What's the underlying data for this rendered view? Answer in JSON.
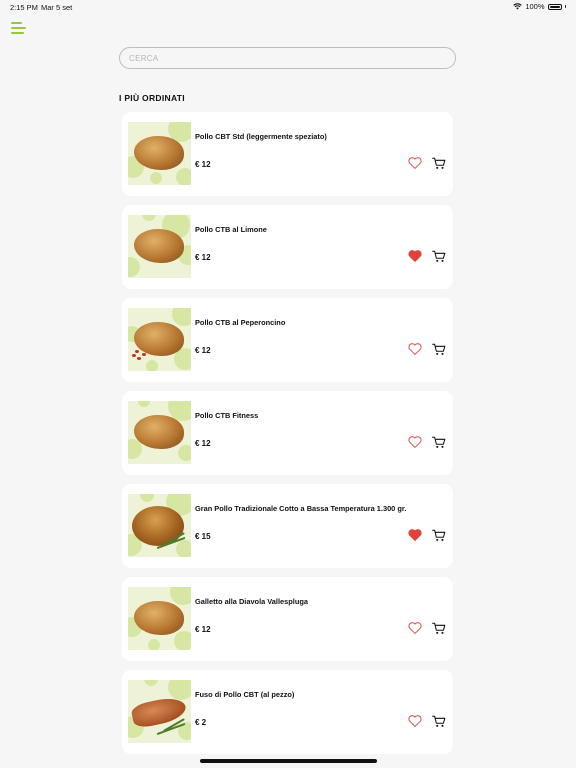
{
  "status_bar": {
    "time": "2:15 PM",
    "date": "Mar 5 set",
    "battery": "100%"
  },
  "search": {
    "placeholder": "CERCA"
  },
  "section_title": "I PIÙ ORDINATI",
  "colors": {
    "accent": "#9bc53d",
    "favorite_active": "#e0433a",
    "favorite_inactive": "#d9534f"
  },
  "products": [
    {
      "name": "Pollo CBT Std  (leggermente speziato)",
      "price": "€ 12",
      "favorite": false
    },
    {
      "name": "Pollo CTB al Limone",
      "price": "€ 12",
      "favorite": true
    },
    {
      "name": "Pollo CTB al Peperoncino",
      "price": "€ 12",
      "favorite": false
    },
    {
      "name": "Pollo CTB Fitness",
      "price": "€ 12",
      "favorite": false
    },
    {
      "name": "Gran Pollo Tradizionale Cotto a Bassa Temperatura 1.300 gr.",
      "price": "€ 15",
      "favorite": true
    },
    {
      "name": "Galletto alla Diavola Vallespluga",
      "price": "€ 12",
      "favorite": false
    },
    {
      "name": "Fuso di Pollo CBT (al pezzo)",
      "price": "€ 2",
      "favorite": false
    }
  ],
  "icons": {
    "menu": "menu-icon",
    "favorite": "heart-icon",
    "cart": "cart-icon",
    "wifi": "wifi-icon",
    "battery": "battery-icon"
  }
}
